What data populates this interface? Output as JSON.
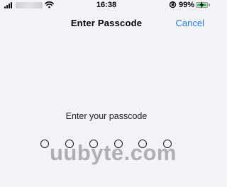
{
  "status_bar": {
    "time": "16:38",
    "battery_percent": "99%",
    "battery_level": 0.99,
    "icons": [
      "signal-icon",
      "wifi-icon",
      "orientation-lock-icon",
      "battery-icon",
      "charging-bolt-icon"
    ]
  },
  "nav": {
    "title": "Enter Passcode",
    "cancel_label": "Cancel"
  },
  "passcode": {
    "prompt": "Enter your passcode",
    "length": 6,
    "entered": 0
  },
  "watermark": {
    "text": "uubyte.com"
  },
  "colors": {
    "accent": "#1a7cf4",
    "background": "#f2f2f7",
    "battery": "#34c759"
  }
}
